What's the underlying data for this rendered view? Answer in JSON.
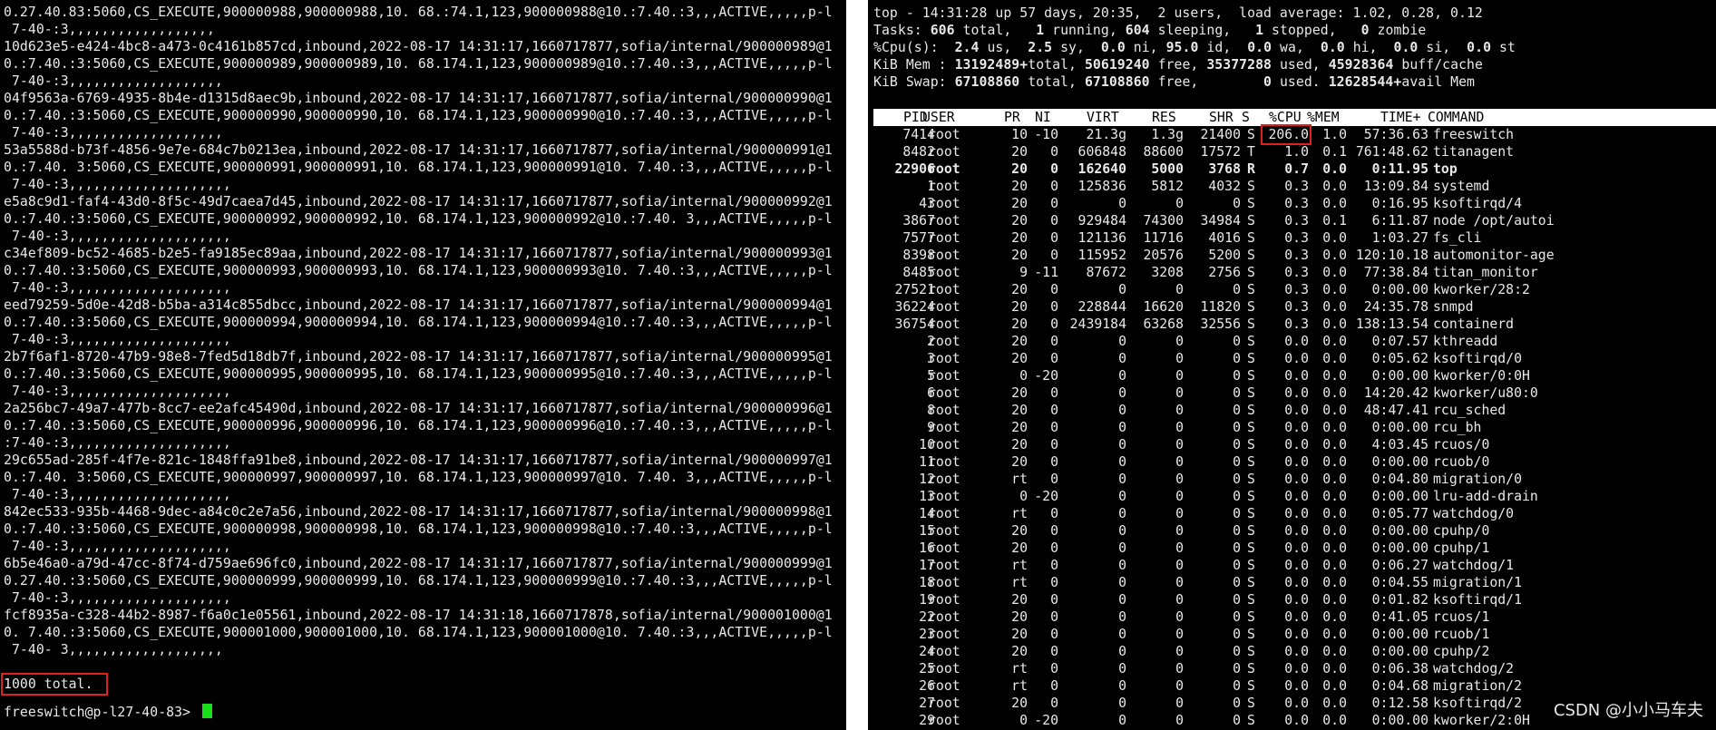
{
  "left_terminal": {
    "lines": [
      "0.27.40.83:5060,CS_EXECUTE,900000988,900000988,10. 68.:74.1,123,900000988@10.:7.40.:3,,,ACTIVE,,,,,p-l",
      " 7-40-:3,,,,,,,,,,,,,,,,,,",
      "10d623e5-e424-4bc8-a473-0c4161b857cd,inbound,2022-08-17 14:31:17,1660717877,sofia/internal/900000989@1",
      "0.:7.40.:3:5060,CS_EXECUTE,900000989,900000989,10. 68.174.1,123,900000989@10.:7.40.:3,,,ACTIVE,,,,,p-l",
      " 7-40-:3,,,,,,,,,,,,,,,,,,,",
      "04f9563a-6769-4935-8b4e-d1315d8aec9b,inbound,2022-08-17 14:31:17,1660717877,sofia/internal/900000990@1",
      "0.:7.40.:3:5060,CS_EXECUTE,900000990,900000990,10. 68.174.1,123,900000990@10.:7.40.:3,,,ACTIVE,,,,,p-l",
      " 7-40-:3,,,,,,,,,,,,,,,,,,,",
      "53a5588d-b73f-4856-9e7e-684c7b0213ea,inbound,2022-08-17 14:31:17,1660717877,sofia/internal/900000991@1",
      "0.:7.40. 3:5060,CS_EXECUTE,900000991,900000991,10. 68.174.1,123,900000991@10. 7.40.:3,,,ACTIVE,,,,,p-l",
      " 7-40-:3,,,,,,,,,,,,,,,,,,,,",
      "e5a8c9d1-faf4-43d0-8f5c-49d7caea7d45,inbound,2022-08-17 14:31:17,1660717877,sofia/internal/900000992@1",
      "0.:7.40.:3:5060,CS_EXECUTE,900000992,900000992,10. 68.174.1,123,900000992@10.:7.40. 3,,,ACTIVE,,,,,p-l",
      " 7-40-:3,,,,,,,,,,,,,,,,,,,,",
      "c34ef809-bc52-4685-b2e5-fa9185ec89aa,inbound,2022-08-17 14:31:17,1660717877,sofia/internal/900000993@1",
      "0.:7.40.:3:5060,CS_EXECUTE,900000993,900000993,10. 68.174.1,123,900000993@10. 7.40.:3,,,ACTIVE,,,,,p-l",
      " 7-40-:3,,,,,,,,,,,,,,,,,,,,",
      "eed79259-5d0e-42d8-b5ba-a314c855dbcc,inbound,2022-08-17 14:31:17,1660717877,sofia/internal/900000994@1",
      "0.:7.40.:3:5060,CS_EXECUTE,900000994,900000994,10. 68.174.1,123,900000994@10.:7.40.:3,,,ACTIVE,,,,,p-l",
      " 7-40-:3,,,,,,,,,,,,,,,,,,,,",
      "2b7f6af1-8720-47b9-98e8-7fed5d18db7f,inbound,2022-08-17 14:31:17,1660717877,sofia/internal/900000995@1",
      "0.:7.40.:3:5060,CS_EXECUTE,900000995,900000995,10. 68.174.1,123,900000995@10.:7.40.:3,,,ACTIVE,,,,,p-l",
      " 7-40-:3,,,,,,,,,,,,,,,,,,,,",
      "2a256bc7-49a7-477b-8cc7-ee2afc45490d,inbound,2022-08-17 14:31:17,1660717877,sofia/internal/900000996@1",
      "0.:7.40.:3:5060,CS_EXECUTE,900000996,900000996,10. 68.174.1,123,900000996@10.:7.40.:3,,,ACTIVE,,,,,p-l",
      ":7-40-:3,,,,,,,,,,,,,,,,,,,,",
      "29c655ad-285f-4f7e-821c-1848ffa91be8,inbound,2022-08-17 14:31:17,1660717877,sofia/internal/900000997@1",
      "0.:7.40. 3:5060,CS_EXECUTE,900000997,900000997,10. 68.174.1,123,900000997@10. 7.40. 3,,,ACTIVE,,,,,p-l",
      " 7-40-:3,,,,,,,,,,,,,,,,,,,,",
      "842ec533-935b-4468-9dec-a84c0c2e7a56,inbound,2022-08-17 14:31:17,1660717877,sofia/internal/900000998@1",
      "0.:7.40.:3:5060,CS_EXECUTE,900000998,900000998,10. 68.174.1,123,900000998@10.:7.40.:3,,,ACTIVE,,,,,p-l",
      " 7-40-:3,,,,,,,,,,,,,,,,,,,,",
      "6b5e46a0-a79d-47cc-8f74-d759ae696fc0,inbound,2022-08-17 14:31:17,1660717877,sofia/internal/900000999@1",
      "0.27.40.:3:5060,CS_EXECUTE,900000999,900000999,10. 68.174.1,123,900000999@10.:7.40.:3,,,ACTIVE,,,,,p-l",
      " 7-40-:3,,,,,,,,,,,,,,,,,,,,",
      "fcf8935a-c328-44b2-8987-f6a0c1e05561,inbound,2022-08-17 14:31:18,1660717878,sofia/internal/900001000@1",
      "0. 7.40.:3:5060,CS_EXECUTE,900001000,900001000,10. 68.174.1,123,900001000@10. 7.40.:3,,,ACTIVE,,,,,p-l",
      " 7-40- 3,,,,,,,,,,,,,,,,,,,"
    ],
    "total": "1000 total.",
    "prompt": "freeswitch@p-l27-40-83> "
  },
  "top": {
    "summary_line": "top - 14:31:28 up 57 days, 20:35,  2 users,  load average: 1.02, 0.28, 0.12",
    "tasks": [
      "Tasks: ",
      "606",
      " total,   ",
      "1",
      " running, ",
      "604",
      " sleeping,   ",
      "1",
      " stopped,   ",
      "0",
      " zombie"
    ],
    "cpu": [
      "%Cpu(s):  ",
      "2.4",
      " us,  ",
      "2.5",
      " sy,  ",
      "0.0",
      " ni, ",
      "95.0",
      " id,  ",
      "0.0",
      " wa,  ",
      "0.0",
      " hi,  ",
      "0.0",
      " si,  ",
      "0.0",
      " st"
    ],
    "mem": [
      "KiB Mem : ",
      "13192489+",
      "total, ",
      "50619240",
      " free, ",
      "35377288",
      " used, ",
      "45928364",
      " buff/cache"
    ],
    "swap": [
      "KiB Swap: ",
      "67108860",
      " total, ",
      "67108860",
      " free,        ",
      "0",
      " used. ",
      "12628544+",
      "avail Mem"
    ],
    "columns": [
      "PID",
      "USER",
      "PR",
      "NI",
      "VIRT",
      "RES",
      "SHR",
      "S",
      "%CPU",
      "%MEM",
      "TIME+",
      "COMMAND"
    ],
    "processes": [
      [
        "7414",
        "root",
        "10",
        "-10",
        "21.3g",
        "1.3g",
        "21400",
        "S",
        "206.0",
        "1.0",
        "57:36.63",
        "freeswitch"
      ],
      [
        "8482",
        "root",
        "20",
        "0",
        "606848",
        "88600",
        "17572",
        "T",
        "1.0",
        "0.1",
        "761:48.62",
        "titanagent"
      ],
      [
        "22906",
        "root",
        "20",
        "0",
        "162640",
        "5000",
        "3768",
        "R",
        "0.7",
        "0.0",
        "0:11.95",
        "top"
      ],
      [
        "1",
        "root",
        "20",
        "0",
        "125836",
        "5812",
        "4032",
        "S",
        "0.3",
        "0.0",
        "13:09.84",
        "systemd"
      ],
      [
        "43",
        "root",
        "20",
        "0",
        "0",
        "0",
        "0",
        "S",
        "0.3",
        "0.0",
        "0:16.95",
        "ksoftirqd/4"
      ],
      [
        "3867",
        "root",
        "20",
        "0",
        "929484",
        "74300",
        "34984",
        "S",
        "0.3",
        "0.1",
        "6:11.87",
        "node /opt/autoi"
      ],
      [
        "7577",
        "root",
        "20",
        "0",
        "121136",
        "11716",
        "4016",
        "S",
        "0.3",
        "0.0",
        "1:03.27",
        "fs_cli"
      ],
      [
        "8398",
        "root",
        "20",
        "0",
        "115952",
        "20576",
        "5200",
        "S",
        "0.3",
        "0.0",
        "120:10.18",
        "automonitor-age"
      ],
      [
        "8485",
        "root",
        "9",
        "-11",
        "87672",
        "3208",
        "2756",
        "S",
        "0.3",
        "0.0",
        "77:38.84",
        "titan_monitor"
      ],
      [
        "27521",
        "root",
        "20",
        "0",
        "0",
        "0",
        "0",
        "S",
        "0.3",
        "0.0",
        "0:00.00",
        "kworker/28:2"
      ],
      [
        "36224",
        "root",
        "20",
        "0",
        "228844",
        "16620",
        "11820",
        "S",
        "0.3",
        "0.0",
        "24:35.78",
        "snmpd"
      ],
      [
        "36754",
        "root",
        "20",
        "0",
        "2439184",
        "63268",
        "32556",
        "S",
        "0.3",
        "0.0",
        "138:13.54",
        "containerd"
      ],
      [
        "2",
        "root",
        "20",
        "0",
        "0",
        "0",
        "0",
        "S",
        "0.0",
        "0.0",
        "0:07.57",
        "kthreadd"
      ],
      [
        "3",
        "root",
        "20",
        "0",
        "0",
        "0",
        "0",
        "S",
        "0.0",
        "0.0",
        "0:05.62",
        "ksoftirqd/0"
      ],
      [
        "5",
        "root",
        "0",
        "-20",
        "0",
        "0",
        "0",
        "S",
        "0.0",
        "0.0",
        "0:00.00",
        "kworker/0:0H"
      ],
      [
        "6",
        "root",
        "20",
        "0",
        "0",
        "0",
        "0",
        "S",
        "0.0",
        "0.0",
        "14:20.42",
        "kworker/u80:0"
      ],
      [
        "8",
        "root",
        "20",
        "0",
        "0",
        "0",
        "0",
        "S",
        "0.0",
        "0.0",
        "48:47.41",
        "rcu_sched"
      ],
      [
        "9",
        "root",
        "20",
        "0",
        "0",
        "0",
        "0",
        "S",
        "0.0",
        "0.0",
        "0:00.00",
        "rcu_bh"
      ],
      [
        "10",
        "root",
        "20",
        "0",
        "0",
        "0",
        "0",
        "S",
        "0.0",
        "0.0",
        "4:03.45",
        "rcuos/0"
      ],
      [
        "11",
        "root",
        "20",
        "0",
        "0",
        "0",
        "0",
        "S",
        "0.0",
        "0.0",
        "0:00.00",
        "rcuob/0"
      ],
      [
        "12",
        "root",
        "rt",
        "0",
        "0",
        "0",
        "0",
        "S",
        "0.0",
        "0.0",
        "0:04.80",
        "migration/0"
      ],
      [
        "13",
        "root",
        "0",
        "-20",
        "0",
        "0",
        "0",
        "S",
        "0.0",
        "0.0",
        "0:00.00",
        "lru-add-drain"
      ],
      [
        "14",
        "root",
        "rt",
        "0",
        "0",
        "0",
        "0",
        "S",
        "0.0",
        "0.0",
        "0:05.77",
        "watchdog/0"
      ],
      [
        "15",
        "root",
        "20",
        "0",
        "0",
        "0",
        "0",
        "S",
        "0.0",
        "0.0",
        "0:00.00",
        "cpuhp/0"
      ],
      [
        "16",
        "root",
        "20",
        "0",
        "0",
        "0",
        "0",
        "S",
        "0.0",
        "0.0",
        "0:00.00",
        "cpuhp/1"
      ],
      [
        "17",
        "root",
        "rt",
        "0",
        "0",
        "0",
        "0",
        "S",
        "0.0",
        "0.0",
        "0:06.27",
        "watchdog/1"
      ],
      [
        "18",
        "root",
        "rt",
        "0",
        "0",
        "0",
        "0",
        "S",
        "0.0",
        "0.0",
        "0:04.55",
        "migration/1"
      ],
      [
        "19",
        "root",
        "20",
        "0",
        "0",
        "0",
        "0",
        "S",
        "0.0",
        "0.0",
        "0:01.82",
        "ksoftirqd/1"
      ],
      [
        "22",
        "root",
        "20",
        "0",
        "0",
        "0",
        "0",
        "S",
        "0.0",
        "0.0",
        "0:41.05",
        "rcuos/1"
      ],
      [
        "23",
        "root",
        "20",
        "0",
        "0",
        "0",
        "0",
        "S",
        "0.0",
        "0.0",
        "0:00.00",
        "rcuob/1"
      ],
      [
        "24",
        "root",
        "20",
        "0",
        "0",
        "0",
        "0",
        "S",
        "0.0",
        "0.0",
        "0:00.00",
        "cpuhp/2"
      ],
      [
        "25",
        "root",
        "rt",
        "0",
        "0",
        "0",
        "0",
        "S",
        "0.0",
        "0.0",
        "0:06.38",
        "watchdog/2"
      ],
      [
        "26",
        "root",
        "rt",
        "0",
        "0",
        "0",
        "0",
        "S",
        "0.0",
        "0.0",
        "0:04.68",
        "migration/2"
      ],
      [
        "27",
        "root",
        "20",
        "0",
        "0",
        "0",
        "0",
        "S",
        "0.0",
        "0.0",
        "0:12.58",
        "ksoftirqd/2"
      ],
      [
        "29",
        "root",
        "0",
        "-20",
        "0",
        "0",
        "0",
        "S",
        "0.0",
        "0.0",
        "0:00.00",
        "kworker/2:0H"
      ]
    ]
  },
  "watermark": "CSDN @小小马车夫",
  "colors": {
    "background": "#000000",
    "text": "#e8e8e8",
    "highlight_box": "#e0201c",
    "cursor": "#18e018",
    "header_bg": "#ffffff"
  }
}
